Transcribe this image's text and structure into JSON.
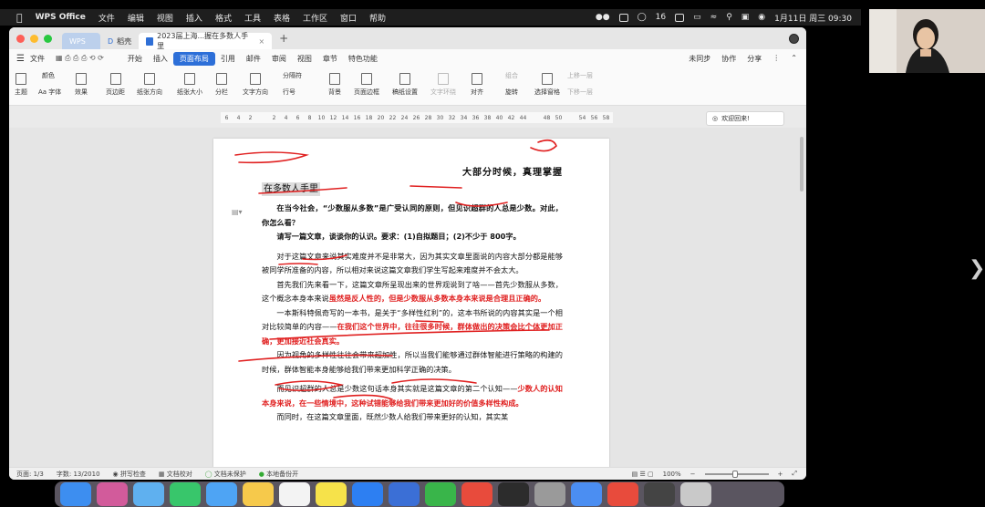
{
  "menubar": {
    "app_name": "WPS Office",
    "items": [
      "文件",
      "编辑",
      "视图",
      "插入",
      "格式",
      "工具",
      "表格",
      "工作区",
      "窗口",
      "帮助"
    ],
    "battery_count": "16",
    "datetime": "1月11日 周三 09:30"
  },
  "tabs": [
    {
      "label": "WPS"
    },
    {
      "label": "稻壳"
    },
    {
      "label": "2023届上海...握在多数人手里"
    }
  ],
  "ribbon_menu": {
    "file": "文件",
    "items": [
      "开始",
      "插入",
      "页面布局",
      "引用",
      "邮件",
      "审阅",
      "视图",
      "章节",
      "特色功能"
    ],
    "active": "页面布局",
    "right": [
      "未同步",
      "协作",
      "分享"
    ]
  },
  "toolbar": {
    "theme": "主题",
    "colors": "颜色",
    "fonts": "Aa 字体",
    "effects": "效果",
    "margins": "页边距",
    "orientation": "纸张方向",
    "size": "纸张大小",
    "columns": "分栏",
    "text_direction": "文字方向",
    "breaks": "分隔符",
    "line_numbers": "行号",
    "background": "背景",
    "page_border": "页面边框",
    "manuscript": "稿纸设置",
    "text_wrap": "文字环绕",
    "align": "对齐",
    "rotate": "旋转",
    "selection_pane": "选择窗格",
    "group": "组合",
    "bring_forward": "上移一层",
    "send_backward": "下移一层"
  },
  "ruler": {
    "ticks": [
      "6",
      "4",
      "2",
      "",
      "2",
      "4",
      "6",
      "8",
      "10",
      "12",
      "14",
      "16",
      "18",
      "20",
      "22",
      "24",
      "26",
      "28",
      "30",
      "32",
      "34",
      "36",
      "38",
      "40",
      "42",
      "44",
      "",
      "48",
      "50",
      "",
      "54",
      "56",
      "58"
    ]
  },
  "welcome": "欢迎回来!",
  "document": {
    "title": "大部分时候，真理掌握",
    "subtitle": "在多数人手里",
    "prompt1": "在当今社会，“少数服从多数”是广受认同的原则，但见识超群的人总是少数。对此，你怎么看？",
    "prompt2": "请写一篇文章，谈谈你的认识。要求：(1)自拟题目；(2)不少于 800字。",
    "para1": "对于这篇文章来说其实难度并不是非常大，因为其实文章里面说的内容大部分都是能够被同学所准备的内容，所以相对来说这篇文章我们学生写起来难度并不会太大。",
    "para2_a": "首先我们先来看一下，这篇文章所呈现出来的世界观说到了啥——首先少数服从多数，这个概念本身本来说",
    "para2_b": "虽然是反人性的，但是少数服从多数本身本来说是合理且正确的。",
    "para3_a": "一本斯科特佩奇写的一本书，是关于“多样性红利”的，这本书所说的内容其实是一个相对比较简单的内容——",
    "para3_b": "在我们这个世界中，往往很多时候，群体做出的决策会比个体更加正确，更加接近社会真实。",
    "para4": "因为视角的多样性往往会带来超加性，所以当我们能够通过群体智能进行策略的构建的时候，群体智能本身能够给我们带来更加科学正确的决策。",
    "para5_a": "而见识超群的人总是少数这句话本身其实就是这篇文章的第二个认知——",
    "para5_b": "少数人的认知本身来说，在一些情境中，这种试错能够给我们带来更加好的价值多样性构成。",
    "para6": "而同时，在这篇文章里面，既然少数人给我们带来更好的认知，其实某"
  },
  "status": {
    "page": "页面: 1/3",
    "words": "字数: 13/2010",
    "spell": "拼写检查",
    "proof": "文档校对",
    "unprotected": "文档未保护",
    "backup": "本地备份开",
    "zoom": "100%"
  },
  "colors": {
    "accent": "#2d6fd8",
    "ink": "#e02020"
  }
}
